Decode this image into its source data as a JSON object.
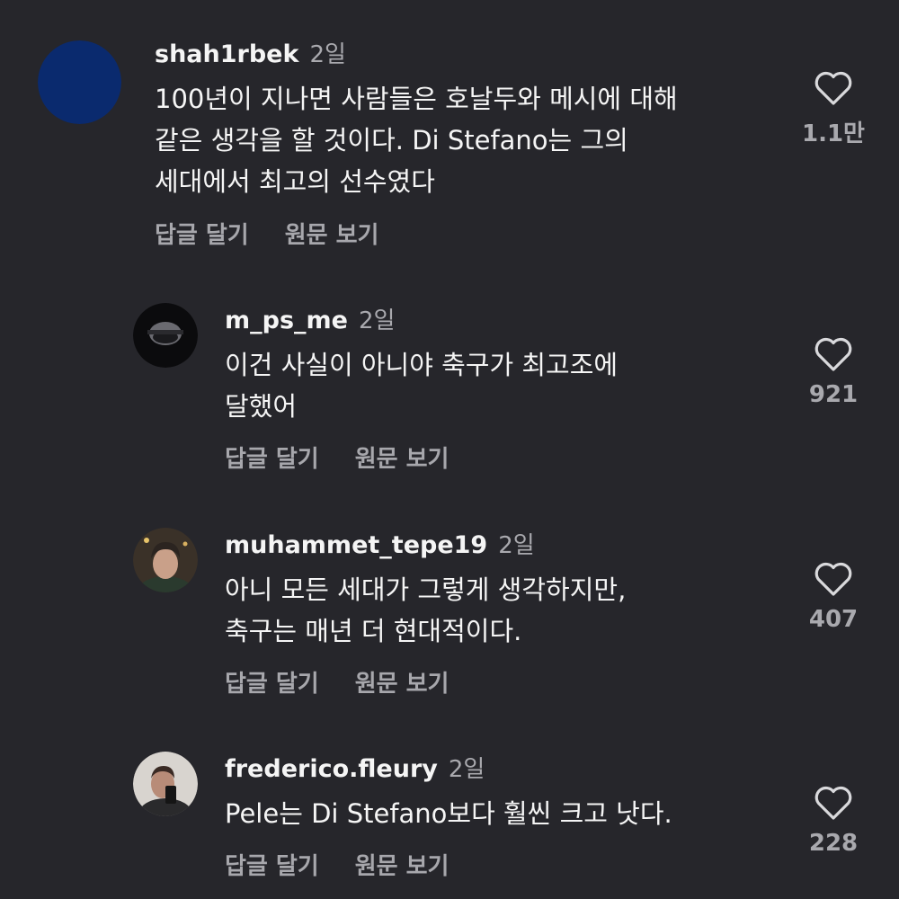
{
  "comments": [
    {
      "username": "shah1rbek",
      "time": "2일",
      "text": "100년이 지나면 사람들은 호날두와 메시에 대해\n같은 생각을 할 것이다. Di Stefano는 그의\n세대에서 최고의 선수였다",
      "reply_label": "답글 달기",
      "original_label": "원문 보기",
      "likes": "1.1만"
    },
    {
      "username": "m_ps_me",
      "time": "2일",
      "text": "이건 사실이 아니야 축구가 최고조에\n달했어",
      "reply_label": "답글 달기",
      "original_label": "원문 보기",
      "likes": "921"
    },
    {
      "username": "muhammet_tepe19",
      "time": "2일",
      "text": "아니 모든 세대가 그렇게 생각하지만,\n축구는 매년 더 현대적이다.",
      "reply_label": "답글 달기",
      "original_label": "원문 보기",
      "likes": "407"
    },
    {
      "username": "frederico.fleury",
      "time": "2일",
      "text": "Pele는 Di Stefano보다 훨씬 크고 낫다.",
      "reply_label": "답글 달기",
      "original_label": "원문 보기",
      "likes": "228"
    }
  ],
  "colors": {
    "background": "#26262b",
    "primary_text": "#f5f5f5",
    "secondary_text": "#a9a9ae",
    "avatar_blue": "#0a2a6e"
  },
  "icons": {
    "like": "heart-outline-icon"
  }
}
